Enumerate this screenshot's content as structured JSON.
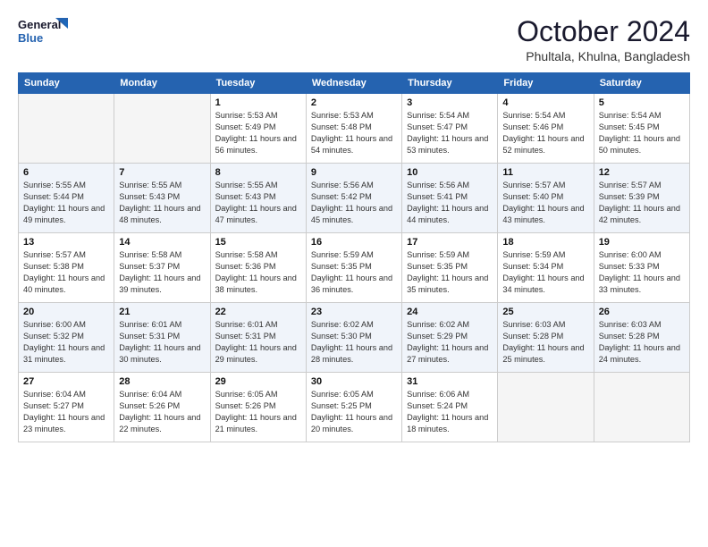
{
  "logo": {
    "line1": "General",
    "line2": "Blue"
  },
  "title": "October 2024",
  "subtitle": "Phultala, Khulna, Bangladesh",
  "weekdays": [
    "Sunday",
    "Monday",
    "Tuesday",
    "Wednesday",
    "Thursday",
    "Friday",
    "Saturday"
  ],
  "weeks": [
    [
      {
        "day": "",
        "info": ""
      },
      {
        "day": "",
        "info": ""
      },
      {
        "day": "1",
        "info": "Sunrise: 5:53 AM\nSunset: 5:49 PM\nDaylight: 11 hours and 56 minutes."
      },
      {
        "day": "2",
        "info": "Sunrise: 5:53 AM\nSunset: 5:48 PM\nDaylight: 11 hours and 54 minutes."
      },
      {
        "day": "3",
        "info": "Sunrise: 5:54 AM\nSunset: 5:47 PM\nDaylight: 11 hours and 53 minutes."
      },
      {
        "day": "4",
        "info": "Sunrise: 5:54 AM\nSunset: 5:46 PM\nDaylight: 11 hours and 52 minutes."
      },
      {
        "day": "5",
        "info": "Sunrise: 5:54 AM\nSunset: 5:45 PM\nDaylight: 11 hours and 50 minutes."
      }
    ],
    [
      {
        "day": "6",
        "info": "Sunrise: 5:55 AM\nSunset: 5:44 PM\nDaylight: 11 hours and 49 minutes."
      },
      {
        "day": "7",
        "info": "Sunrise: 5:55 AM\nSunset: 5:43 PM\nDaylight: 11 hours and 48 minutes."
      },
      {
        "day": "8",
        "info": "Sunrise: 5:55 AM\nSunset: 5:43 PM\nDaylight: 11 hours and 47 minutes."
      },
      {
        "day": "9",
        "info": "Sunrise: 5:56 AM\nSunset: 5:42 PM\nDaylight: 11 hours and 45 minutes."
      },
      {
        "day": "10",
        "info": "Sunrise: 5:56 AM\nSunset: 5:41 PM\nDaylight: 11 hours and 44 minutes."
      },
      {
        "day": "11",
        "info": "Sunrise: 5:57 AM\nSunset: 5:40 PM\nDaylight: 11 hours and 43 minutes."
      },
      {
        "day": "12",
        "info": "Sunrise: 5:57 AM\nSunset: 5:39 PM\nDaylight: 11 hours and 42 minutes."
      }
    ],
    [
      {
        "day": "13",
        "info": "Sunrise: 5:57 AM\nSunset: 5:38 PM\nDaylight: 11 hours and 40 minutes."
      },
      {
        "day": "14",
        "info": "Sunrise: 5:58 AM\nSunset: 5:37 PM\nDaylight: 11 hours and 39 minutes."
      },
      {
        "day": "15",
        "info": "Sunrise: 5:58 AM\nSunset: 5:36 PM\nDaylight: 11 hours and 38 minutes."
      },
      {
        "day": "16",
        "info": "Sunrise: 5:59 AM\nSunset: 5:35 PM\nDaylight: 11 hours and 36 minutes."
      },
      {
        "day": "17",
        "info": "Sunrise: 5:59 AM\nSunset: 5:35 PM\nDaylight: 11 hours and 35 minutes."
      },
      {
        "day": "18",
        "info": "Sunrise: 5:59 AM\nSunset: 5:34 PM\nDaylight: 11 hours and 34 minutes."
      },
      {
        "day": "19",
        "info": "Sunrise: 6:00 AM\nSunset: 5:33 PM\nDaylight: 11 hours and 33 minutes."
      }
    ],
    [
      {
        "day": "20",
        "info": "Sunrise: 6:00 AM\nSunset: 5:32 PM\nDaylight: 11 hours and 31 minutes."
      },
      {
        "day": "21",
        "info": "Sunrise: 6:01 AM\nSunset: 5:31 PM\nDaylight: 11 hours and 30 minutes."
      },
      {
        "day": "22",
        "info": "Sunrise: 6:01 AM\nSunset: 5:31 PM\nDaylight: 11 hours and 29 minutes."
      },
      {
        "day": "23",
        "info": "Sunrise: 6:02 AM\nSunset: 5:30 PM\nDaylight: 11 hours and 28 minutes."
      },
      {
        "day": "24",
        "info": "Sunrise: 6:02 AM\nSunset: 5:29 PM\nDaylight: 11 hours and 27 minutes."
      },
      {
        "day": "25",
        "info": "Sunrise: 6:03 AM\nSunset: 5:28 PM\nDaylight: 11 hours and 25 minutes."
      },
      {
        "day": "26",
        "info": "Sunrise: 6:03 AM\nSunset: 5:28 PM\nDaylight: 11 hours and 24 minutes."
      }
    ],
    [
      {
        "day": "27",
        "info": "Sunrise: 6:04 AM\nSunset: 5:27 PM\nDaylight: 11 hours and 23 minutes."
      },
      {
        "day": "28",
        "info": "Sunrise: 6:04 AM\nSunset: 5:26 PM\nDaylight: 11 hours and 22 minutes."
      },
      {
        "day": "29",
        "info": "Sunrise: 6:05 AM\nSunset: 5:26 PM\nDaylight: 11 hours and 21 minutes."
      },
      {
        "day": "30",
        "info": "Sunrise: 6:05 AM\nSunset: 5:25 PM\nDaylight: 11 hours and 20 minutes."
      },
      {
        "day": "31",
        "info": "Sunrise: 6:06 AM\nSunset: 5:24 PM\nDaylight: 11 hours and 18 minutes."
      },
      {
        "day": "",
        "info": ""
      },
      {
        "day": "",
        "info": ""
      }
    ]
  ]
}
